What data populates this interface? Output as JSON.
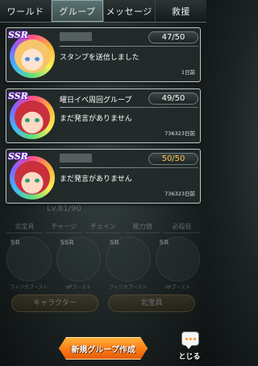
{
  "tabs": [
    {
      "label": "ワールド",
      "active": false
    },
    {
      "label": "グループ",
      "active": true
    },
    {
      "label": "メッセージ",
      "active": false
    },
    {
      "label": "救援",
      "active": false
    }
  ],
  "groups": [
    {
      "rarity": "SSR",
      "avatar_icon": "blonde-character-icon",
      "name": "",
      "name_blurred": true,
      "count": "47/50",
      "message": "スタンプを送信しました",
      "time": "1日前"
    },
    {
      "rarity": "SSR",
      "avatar_icon": "red-hair-character-icon",
      "name": "曜日イベ周回グループ",
      "name_blurred": false,
      "count": "49/50",
      "message": "まだ発言がありません",
      "time": "736323日前"
    },
    {
      "rarity": "SSR",
      "avatar_icon": "red-hair-character-icon",
      "name": "",
      "name_blurred": true,
      "count": "50/50",
      "count_color": "#ffc64a",
      "message": "まだ発言がありません",
      "time": "736323日前"
    }
  ],
  "background": {
    "level": "Lv.81/90",
    "tabs": [
      "北宝具",
      "チャージ",
      "チェイン",
      "能力値",
      "必殺技"
    ],
    "slots": [
      {
        "label": "SR",
        "sub": "フィジカブースト"
      },
      {
        "label": "SSR",
        "sub": "HPブースト"
      },
      {
        "label": "SR",
        "sub": "フィジカブースト"
      },
      {
        "label": "SR",
        "sub": "HPブースト"
      }
    ],
    "buttons": [
      "キャラクター",
      "北宝具"
    ]
  },
  "footer": {
    "create_label": "新規グループ作成",
    "close_label": "とじる"
  },
  "colors": {
    "accent_orange": "#ff7b14",
    "full_count": "#ffc64a"
  }
}
